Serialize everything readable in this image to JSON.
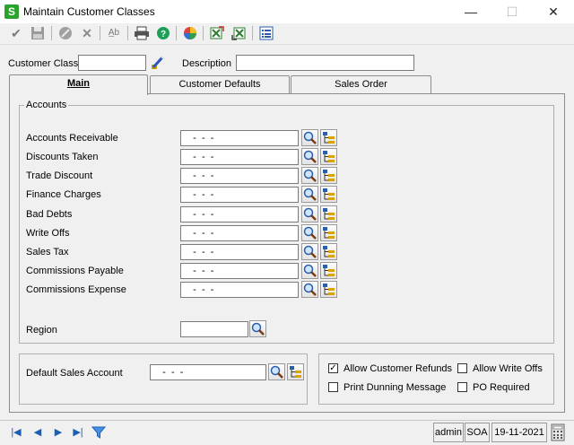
{
  "window": {
    "title": "Maintain Customer Classes",
    "app_icon_letter": "S",
    "minimize": "—",
    "maximize": "☐",
    "close": "✕"
  },
  "toolbar": {
    "icons": [
      "checkmark-icon",
      "save-icon",
      "stop-icon",
      "delete-icon",
      "text-abc-icon",
      "print-icon",
      "help-icon",
      "color-wheel-icon",
      "export-icon",
      "import-icon",
      "list-icon"
    ]
  },
  "header": {
    "customer_class_label": "Customer Class",
    "customer_class_value": "",
    "description_label": "Description",
    "description_value": ""
  },
  "tabs": [
    {
      "label": "Main",
      "active": true
    },
    {
      "label": "Customer Defaults",
      "active": false
    },
    {
      "label": "Sales Order",
      "active": false
    }
  ],
  "accounts": {
    "group_label": "Accounts",
    "rows": [
      {
        "label": "Accounts Receivable",
        "value": "   -  -  -"
      },
      {
        "label": "Discounts Taken",
        "value": "   -  -  -"
      },
      {
        "label": "Trade Discount",
        "value": "   -  -  -"
      },
      {
        "label": "Finance Charges",
        "value": "   -  -  -"
      },
      {
        "label": "Bad Debts",
        "value": "   -  -  -"
      },
      {
        "label": "Write Offs",
        "value": "   -  -  -"
      },
      {
        "label": "Sales Tax",
        "value": "   -  -  -"
      },
      {
        "label": "Commissions Payable",
        "value": "   -  -  -"
      },
      {
        "label": "Commissions Expense",
        "value": "   -  -  -"
      }
    ],
    "region_label": "Region",
    "region_value": ""
  },
  "default_sales": {
    "label": "Default Sales Account",
    "value": "   -  -  -"
  },
  "options": {
    "allow_customer_refunds": {
      "label": "Allow Customer Refunds",
      "checked": true
    },
    "allow_write_offs": {
      "label": "Allow Write Offs",
      "checked": false
    },
    "print_dunning_message": {
      "label": "Print Dunning Message",
      "checked": false
    },
    "po_required": {
      "label": "PO Required",
      "checked": false
    }
  },
  "statusbar": {
    "user": "admin",
    "company": "SOA",
    "date": "19-11-2021"
  },
  "colors": {
    "accent": "#1a5fb4",
    "app_icon": "#2aa32a"
  }
}
